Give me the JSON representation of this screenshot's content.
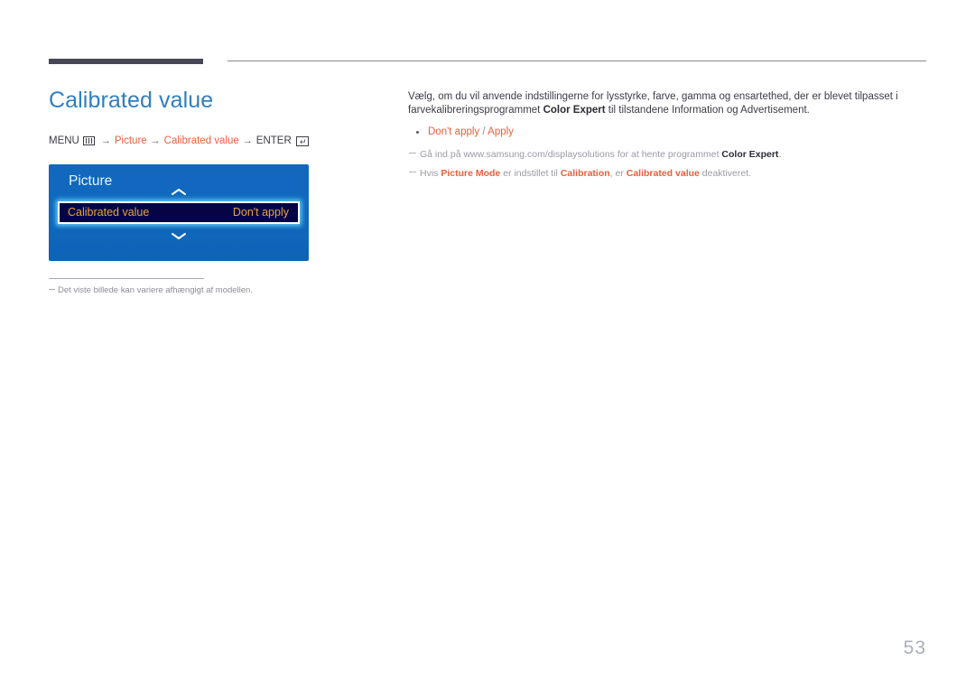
{
  "page": {
    "number": "53"
  },
  "header": {
    "title": "Calibrated value"
  },
  "menu_path": {
    "menu_label": "MENU",
    "menu_icon": "menu-grid-icon",
    "arrow": "→",
    "segment_picture": "Picture",
    "segment_calibrated_value": "Calibrated value",
    "enter_label": "ENTER",
    "enter_icon": "enter-return-icon"
  },
  "osd": {
    "title": "Picture",
    "scroll_up_icon": "chevron-up-icon",
    "scroll_down_icon": "chevron-down-icon",
    "row": {
      "label": "Calibrated value",
      "value": "Don't apply"
    }
  },
  "left_note": {
    "text": "Det viste billede kan variere afhængigt af modellen."
  },
  "content": {
    "intro_part1": "Vælg, om du vil anvende indstillingerne for lysstyrke, farve, gamma og ensartethed, der er blevet tilpasset i farvekalibreringsprogrammet ",
    "intro_bold": "Color Expert",
    "intro_part2": " til tilstandene Information og Advertisement.",
    "bullets": [
      {
        "option_a": "Don't apply",
        "separator": "/",
        "option_b": "Apply"
      }
    ],
    "notes": [
      {
        "p1": "Gå ind på www.samsung.com/displaysolutions for at hente programmet ",
        "b1": "Color Expert",
        "p2": "."
      },
      {
        "p1": "Hvis ",
        "b1": "Picture Mode",
        "p2": " er indstillet til ",
        "b2": "Calibration",
        "p3": ", er ",
        "b3": "Calibrated value",
        "p4": " deaktiveret."
      }
    ]
  },
  "colors": {
    "title_blue": "#2f7fc1",
    "accent_orange": "#e8603c",
    "osd_blue": "#1069be",
    "osd_row_navy": "#050546",
    "osd_value_gold": "#e8a33a",
    "rule_dark": "#474756"
  }
}
